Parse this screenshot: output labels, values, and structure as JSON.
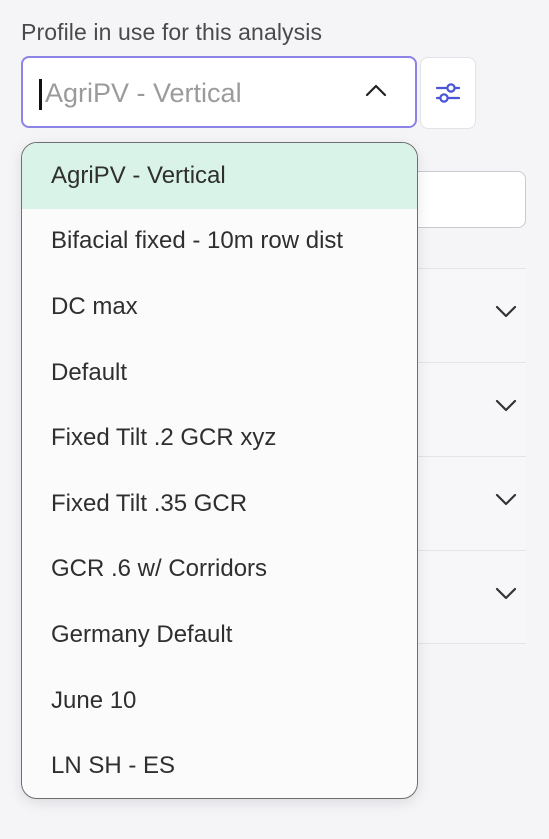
{
  "profile": {
    "label": "Profile in use for this analysis",
    "selected_value": "AgriPV - Vertical"
  },
  "dropdown": {
    "options": [
      "AgriPV - Vertical",
      "Bifacial fixed - 10m row dist",
      "DC max",
      "Default",
      "Fixed Tilt .2 GCR xyz",
      "Fixed Tilt .35 GCR",
      "GCR .6 w/ Corridors",
      "Germany Default",
      "June 10",
      "LN SH - ES"
    ],
    "selected_index": 0
  },
  "colors": {
    "accent": "#8b84e6",
    "icon_blue": "#4a55d6",
    "selected_bg": "#d9f3e8"
  }
}
